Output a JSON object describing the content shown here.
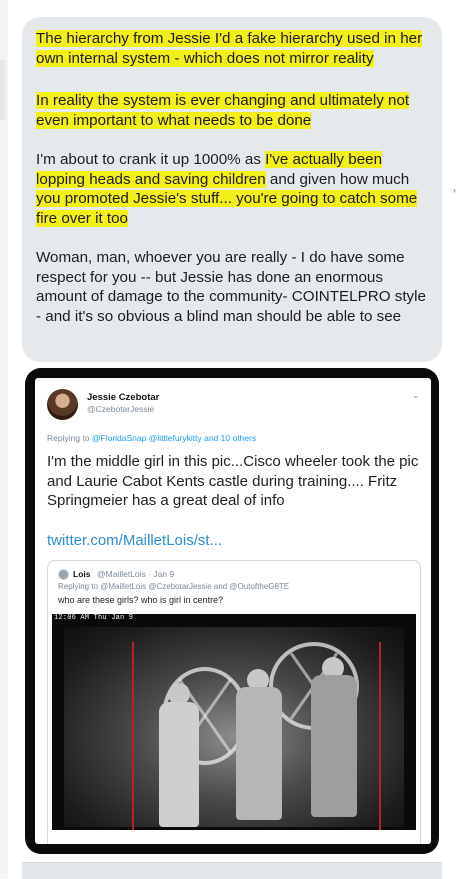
{
  "message": {
    "p1": "The hierarchy from Jessie I'd a fake hierarchy used in her own internal system - which does not mirror reality",
    "p2": "In reality the system is ever changing and ultimately not even important to what needs to be done",
    "p3_plain": "I'm about to crank it up 1000% as ",
    "p3_hl1": "I've actually been lopping heads and saving children",
    "p3_mid": " and given how much ",
    "p3_hl2": "you promoted Jessie's stuff... you're going to catch some fire over it too",
    "p4": "Woman, man, whoever you are really - I do have some respect for you -- but Jessie has done an enormous amount of damage to the community- COINTELPRO style - and it's so obvious a blind man should be able to see"
  },
  "embedded_tweet": {
    "author_name": "Jessie Czebotar",
    "author_handle": "@CzebotarJessie",
    "reply_prefix": "Replying to ",
    "reply_links": "@FloridaSnap @littlefurykitty and 10 others",
    "text": "I'm the middle girl in this pic...Cisco wheeler took the pic and Laurie Cabot Kents castle during training.... Fritz Springmeier has a great deal of info",
    "link": "twitter.com/MailletLois/st...",
    "chevron": "⌄",
    "quote": {
      "name": "Lois",
      "meta": "@MailletLois · Jan 9",
      "reply": "Replying to @MailletLois @CzebotarJessie and @OutoftheG8TE",
      "text": "who are these girls?  who is girl in centre?",
      "photo_timestamp": "12:06 AM  Thu Jan 9"
    }
  },
  "icons": {
    "avatar": "user-avatar",
    "quote_avatar": "user-avatar-small",
    "menu": "chevron-down-icon"
  },
  "colors": {
    "bubble_bg": "#e6e9ec",
    "highlight": "#f3ef19",
    "link": "#2a8fd6"
  }
}
